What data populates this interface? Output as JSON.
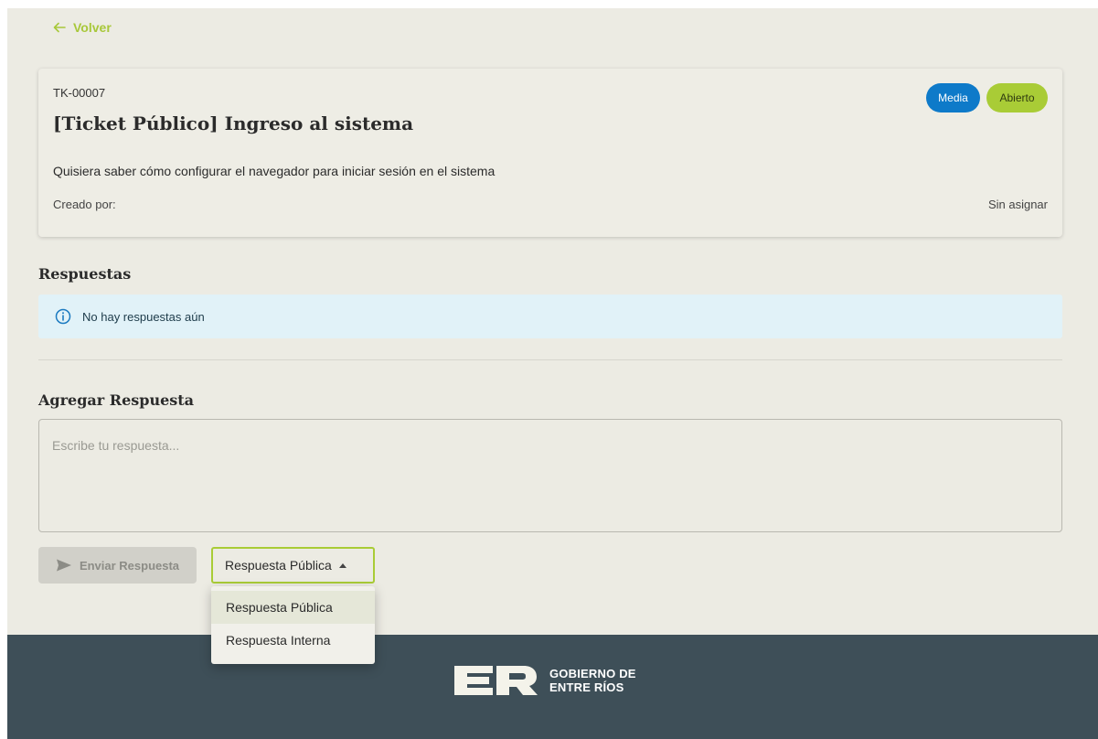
{
  "nav": {
    "back_label": "Volver"
  },
  "ticket": {
    "id": "TK-00007",
    "title": "[Ticket Público] Ingreso al sistema",
    "priority": "Media",
    "status": "Abierto",
    "description": "Quisiera saber cómo configurar el navegador para iniciar sesión en el sistema",
    "created_by_label": "Creado por:",
    "assignee": "Sin asignar"
  },
  "responses": {
    "title": "Respuestas",
    "empty_message": "No hay respuestas aún"
  },
  "add_response": {
    "title": "Agregar Respuesta",
    "placeholder": "Escribe tu respuesta...",
    "value": "",
    "send_label": "Enviar Respuesta",
    "type_selected": "Respuesta Pública",
    "type_options": [
      "Respuesta Pública",
      "Respuesta Interna"
    ]
  },
  "footer": {
    "logo_line1": "GOBIERNO DE",
    "logo_line2": "ENTRE RÍOS"
  },
  "colors": {
    "accent": "#a9cc36",
    "priority_badge": "#0e7ac9",
    "footer_bg": "#3e4f58",
    "page_bg": "#ecebe3",
    "info_bg": "#e1f2f8"
  },
  "icons": {
    "back": "arrow-left-icon",
    "info": "info-circle-icon",
    "send": "send-icon",
    "caret": "caret-up-icon",
    "logo": "er-logo-icon"
  }
}
